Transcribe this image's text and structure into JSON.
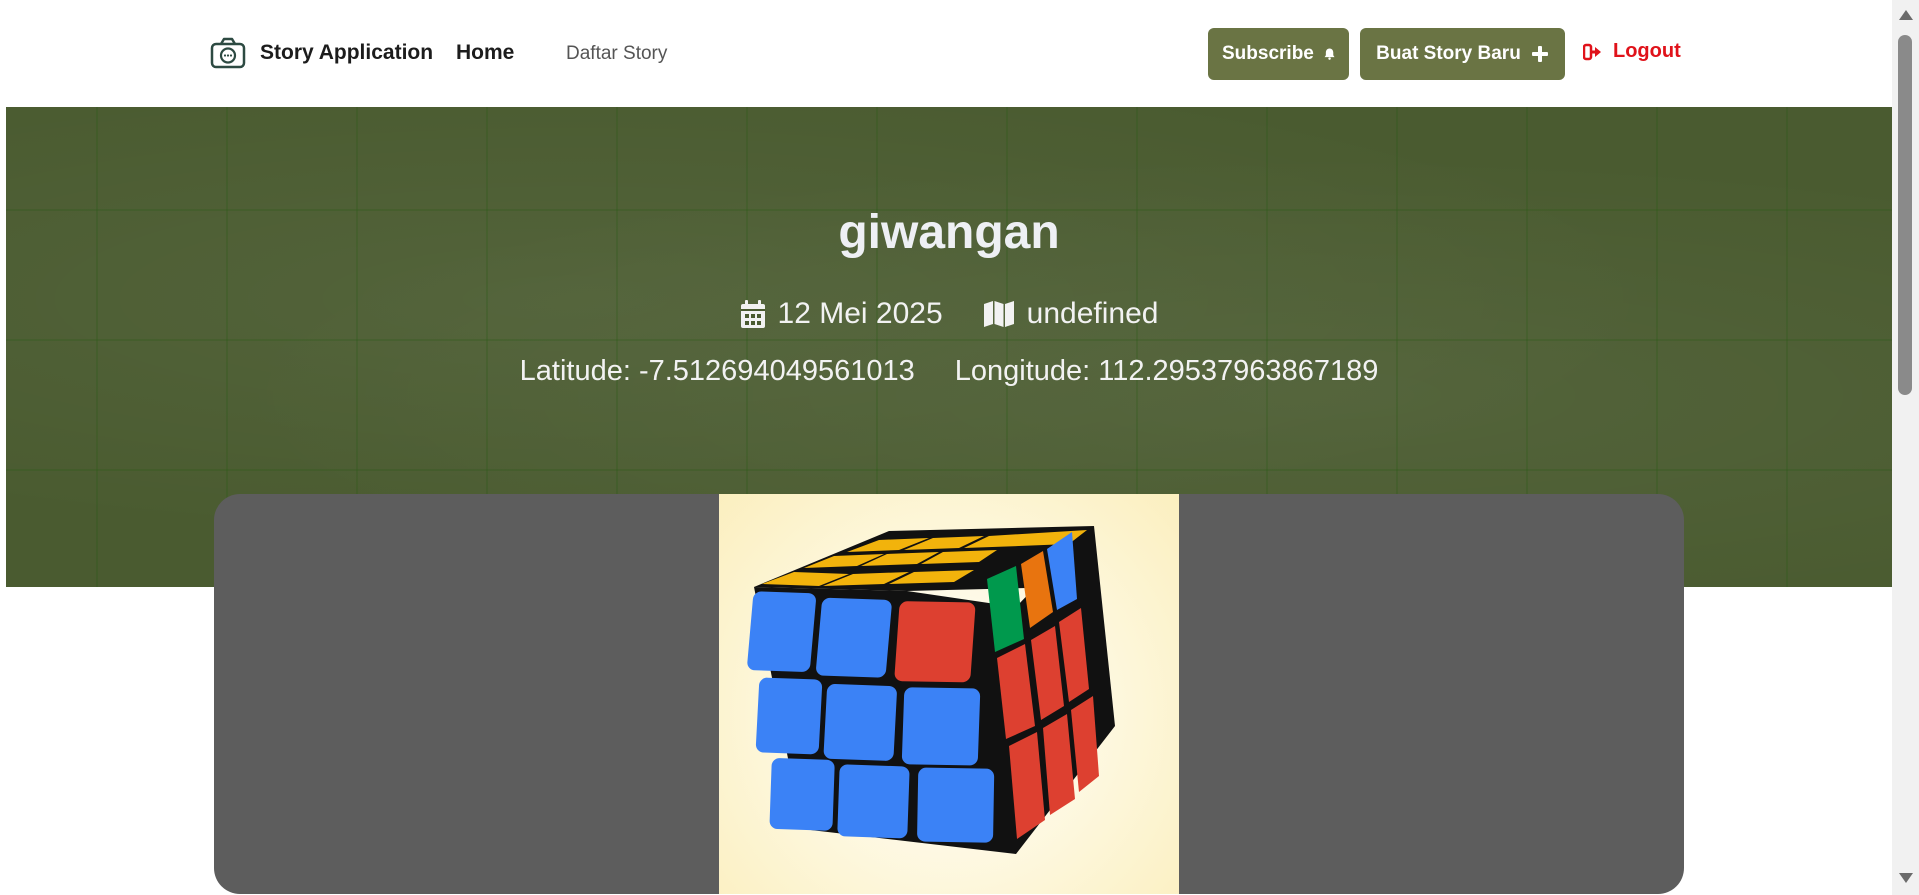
{
  "nav": {
    "brand": "Story Application",
    "home": "Home",
    "daftar_story": "Daftar Story",
    "subscribe": "Subscribe",
    "buat_story": "Buat Story Baru",
    "logout": "Logout"
  },
  "story": {
    "name": "giwangan",
    "date": "12 Mei 2025",
    "location": "undefined",
    "latitude": "Latitude: -7.512694049561013",
    "longitude": "Longitude: 112.29537963867189"
  },
  "colors": {
    "accent": "#6a7444",
    "hero_bg": "#4a5b30",
    "logout": "#e0121a",
    "card_bg": "#5d5d5d"
  },
  "icons": {
    "brand": "camera-chat-icon",
    "subscribe": "bell-icon",
    "buat_story": "plus-icon",
    "logout": "sign-out-icon",
    "date": "calendar-icon",
    "location": "map-icon"
  }
}
